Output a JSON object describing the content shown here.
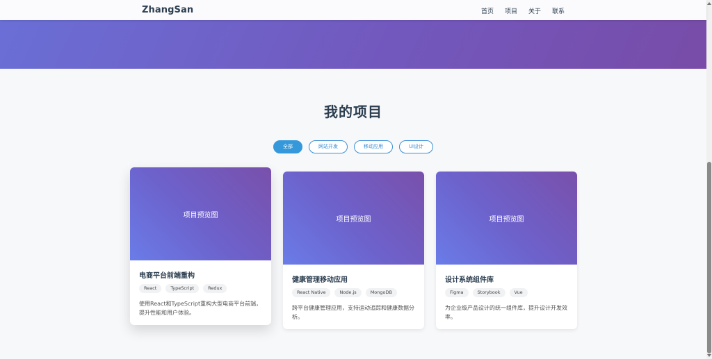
{
  "nav": {
    "logo": "ZhangSan",
    "links": [
      "首页",
      "项目",
      "关于",
      "联系"
    ]
  },
  "section": {
    "title": "我的项目"
  },
  "filters": [
    {
      "label": "全部",
      "active": true
    },
    {
      "label": "网站开发",
      "active": false
    },
    {
      "label": "移动应用",
      "active": false
    },
    {
      "label": "UI设计",
      "active": false
    }
  ],
  "projects": [
    {
      "preview_label": "项目预览图",
      "title": "电商平台前端重构",
      "tags": [
        "React",
        "TypeScript",
        "Redux"
      ],
      "description": "使用React和TypeScript重构大型电商平台前端，提升性能和用户体验。"
    },
    {
      "preview_label": "项目预览图",
      "title": "健康管理移动应用",
      "tags": [
        "React Native",
        "Node.js",
        "MongoDB"
      ],
      "description": "跨平台健康管理应用，支持运动追踪和健康数据分析。"
    },
    {
      "preview_label": "项目预览图",
      "title": "设计系统组件库",
      "tags": [
        "Figma",
        "Storybook",
        "Vue"
      ],
      "description": "为企业级产品设计的统一组件库，提升设计开发效率。"
    }
  ],
  "colors": {
    "accent": "#3498db",
    "text": "#2c3e50",
    "gradient_start": "#6a7ce8",
    "gradient_end": "#7950ab"
  }
}
